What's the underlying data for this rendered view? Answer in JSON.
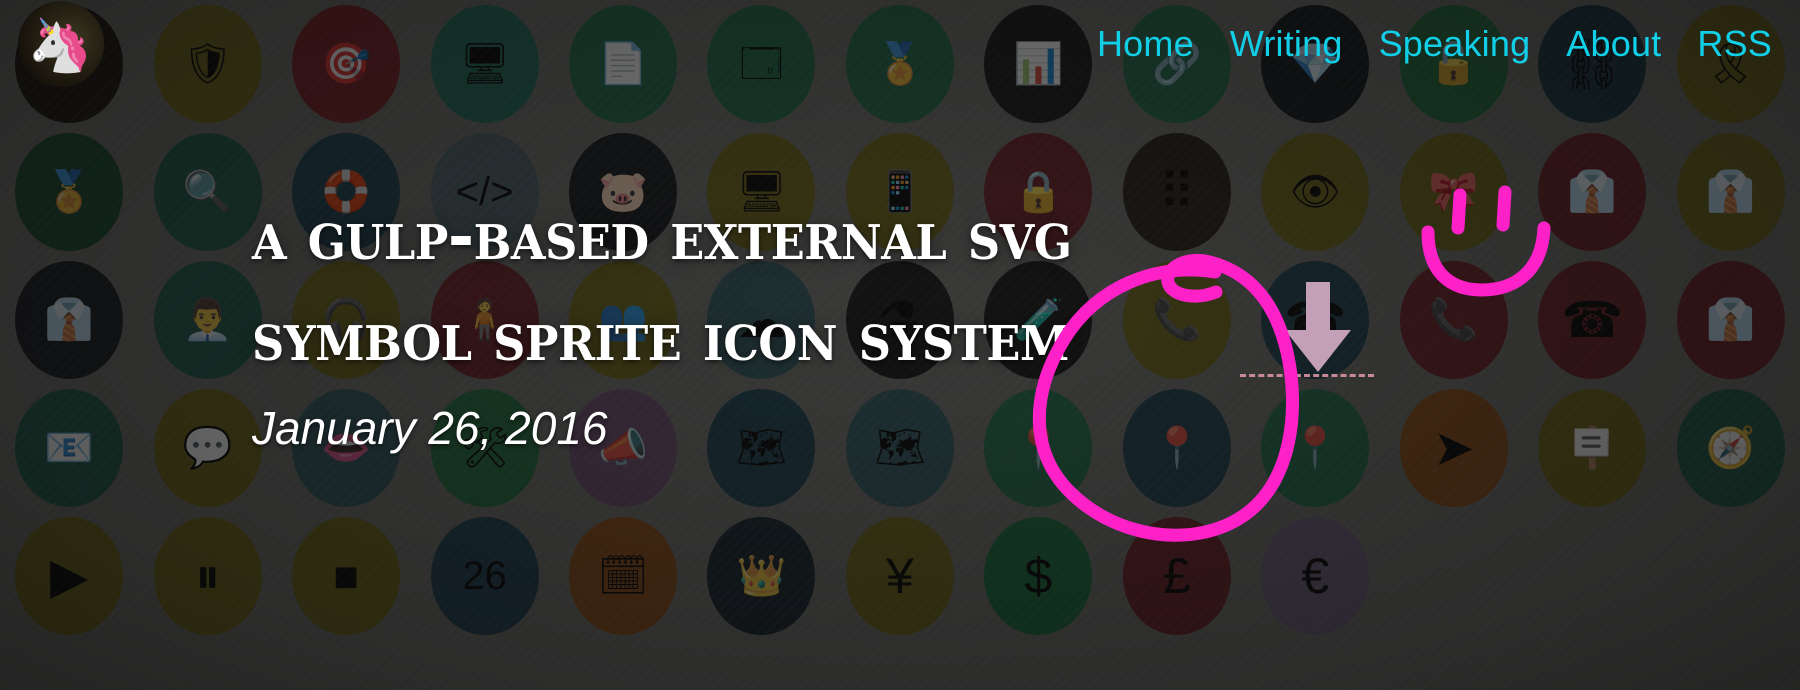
{
  "site": {
    "logo_icon": "unicorn-logo-icon",
    "logo_glyph": "🦄",
    "accent_link_color": "#12cfe8"
  },
  "nav": {
    "items": [
      {
        "label": "Home",
        "name": "nav-link-home"
      },
      {
        "label": "Writing",
        "name": "nav-link-writing"
      },
      {
        "label": "Speaking",
        "name": "nav-link-speaking"
      },
      {
        "label": "About",
        "name": "nav-link-about"
      },
      {
        "label": "RSS",
        "name": "nav-link-rss"
      }
    ]
  },
  "hero": {
    "title": "A Gulp-Based External SVG\nSymbol Sprite Icon System",
    "date": "January 26, 2016",
    "title_color": "#ffffff",
    "date_color": "#ffffff"
  },
  "download_marker": {
    "arrow_icon": "download-arrow-icon",
    "arrow_color": "#c4a0b8",
    "rule_color": "#d08e9e"
  },
  "annotations": {
    "color": "#ff21c8",
    "stroke_width": 13,
    "items": [
      {
        "name": "annotation-circle-highlight",
        "shape": "hand-drawn-circle"
      },
      {
        "name": "annotation-smiley-face",
        "shape": "smiley"
      }
    ]
  },
  "background": {
    "overlay_color": "rgba(20,20,20,0.55)",
    "base_color": "#6e6e6b",
    "icons": [
      {
        "name": "unicorn-logo-icon",
        "glyph": "",
        "bg": "#1a160e"
      },
      {
        "name": "shield-block-icon",
        "glyph": "🛡",
        "bg": "#6b6416"
      },
      {
        "name": "target-icon",
        "glyph": "🎯",
        "bg": "#7a1d22"
      },
      {
        "name": "desktop-chart-icon",
        "glyph": "🖥",
        "bg": "#1f6b5a"
      },
      {
        "name": "document-icon",
        "glyph": "📄",
        "bg": "#1f6b4a"
      },
      {
        "name": "browser-window-icon",
        "glyph": "🗔",
        "bg": "#1f6b4a"
      },
      {
        "name": "certificate-icon",
        "glyph": "🏅",
        "bg": "#1f6b4a"
      },
      {
        "name": "presentation-chart-icon",
        "glyph": "📊",
        "bg": "#141414"
      },
      {
        "name": "link-chain-icon",
        "glyph": "🔗",
        "bg": "#1f6b4a"
      },
      {
        "name": "diamond-icon",
        "glyph": "💎",
        "bg": "#0f1417"
      },
      {
        "name": "padlock-open-icon",
        "glyph": "🔓",
        "bg": "#1f6b3a"
      },
      {
        "name": "handcuffs-icon",
        "glyph": "⛓",
        "bg": "#14343f"
      },
      {
        "name": "ribbon-icon",
        "glyph": "🎗",
        "bg": "#6b6416"
      },
      {
        "name": "award-ribbon-icon",
        "glyph": "🏅",
        "bg": "#184a30"
      },
      {
        "name": "magnifier-icon",
        "glyph": "🔍",
        "bg": "#1e5a49"
      },
      {
        "name": "lifebuoy-icon",
        "glyph": "🛟",
        "bg": "#1b3f4e"
      },
      {
        "name": "code-tag-icon",
        "glyph": "</>",
        "bg": "#4c6166"
      },
      {
        "name": "piggy-bank-icon",
        "glyph": "🐷",
        "bg": "#14181b"
      },
      {
        "name": "desktop-mobile-icon",
        "glyph": "🖥",
        "bg": "#6b6416"
      },
      {
        "name": "smartphone-icon",
        "glyph": "📱",
        "bg": "#6b6416"
      },
      {
        "name": "padlock-closed-icon",
        "glyph": "🔒",
        "bg": "#6b1d24"
      },
      {
        "name": "binary-code-icon",
        "glyph": "⠿",
        "bg": "#241c14"
      },
      {
        "name": "eye-icon",
        "glyph": "👁",
        "bg": "#6b6416"
      },
      {
        "name": "bowtie-icon",
        "glyph": "🎀",
        "bg": "#6b6416"
      },
      {
        "name": "necktie-icon",
        "glyph": "👔",
        "bg": "#6b1d24"
      },
      {
        "name": "tie-dark-icon",
        "glyph": "👔",
        "bg": "#6b6416"
      },
      {
        "name": "tie-icon",
        "glyph": "👔",
        "bg": "#16191d"
      },
      {
        "name": "businessman-icon",
        "glyph": "👨‍💼",
        "bg": "#1e5a49"
      },
      {
        "name": "headphones-support-icon",
        "glyph": "🎧",
        "bg": "#6b6416"
      },
      {
        "name": "person-red-icon",
        "glyph": "🧍",
        "bg": "#6b1d24"
      },
      {
        "name": "team-group-icon",
        "glyph": "👥",
        "bg": "#6b6416"
      },
      {
        "name": "cloud-icon",
        "glyph": "☁",
        "bg": "#2f565c"
      },
      {
        "name": "science-flask-icon",
        "glyph": "⚗",
        "bg": "#141414"
      },
      {
        "name": "lab-bottle-icon",
        "glyph": "🧪",
        "bg": "#141414"
      },
      {
        "name": "phone-ring-icon",
        "glyph": "📞",
        "bg": "#6b6416"
      },
      {
        "name": "telephone-icon",
        "glyph": "☎",
        "bg": "#1b3f4e"
      },
      {
        "name": "phone-call-icon",
        "glyph": "📞",
        "bg": "#6b1d24"
      },
      {
        "name": "phone-old-icon",
        "glyph": "☎",
        "bg": "#6b1d24"
      },
      {
        "name": "tie-stripe-icon",
        "glyph": "👔",
        "bg": "#6b1d24"
      },
      {
        "name": "mobile-mail-icon",
        "glyph": "📧",
        "bg": "#1e5a49"
      },
      {
        "name": "mobile-chat-icon",
        "glyph": "💬",
        "bg": "#6b6416"
      },
      {
        "name": "lips-icon",
        "glyph": "👄",
        "bg": "#2f565c"
      },
      {
        "name": "hammer-wrench-icon",
        "glyph": "🛠",
        "bg": "#1f6b3a"
      },
      {
        "name": "megaphone-icon",
        "glyph": "📣",
        "bg": "#6a4a6b"
      },
      {
        "name": "map-folded-icon",
        "glyph": "🗺",
        "bg": "#1b3f4e"
      },
      {
        "name": "map-pin-route-icon",
        "glyph": "🗺",
        "bg": "#2f565c"
      },
      {
        "name": "location-pin-red-icon",
        "glyph": "📍",
        "bg": "#1f6b4a"
      },
      {
        "name": "location-pin-gold-icon",
        "glyph": "📍",
        "bg": "#1b3f4e"
      },
      {
        "name": "location-pin-icon",
        "glyph": "📍",
        "bg": "#1f6b4a"
      },
      {
        "name": "navigation-arrow-icon",
        "glyph": "➤",
        "bg": "#8a4a14"
      },
      {
        "name": "signpost-icon",
        "glyph": "🪧",
        "bg": "#6b6416"
      },
      {
        "name": "compass-icon",
        "glyph": "🧭",
        "bg": "#1e5a49"
      },
      {
        "name": "play-slider-icon",
        "glyph": "▶",
        "bg": "#6b6416"
      },
      {
        "name": "pause-slider-icon",
        "glyph": "⏸",
        "bg": "#6b6416"
      },
      {
        "name": "stop-slider-icon",
        "glyph": "⏹",
        "bg": "#6b6416"
      },
      {
        "name": "calendar-26-icon",
        "glyph": "26",
        "bg": "#1b3f4e"
      },
      {
        "name": "calendar-grid-icon",
        "glyph": "🗓",
        "bg": "#8a4a14"
      },
      {
        "name": "crown-icon",
        "glyph": "👑",
        "bg": "#14222c"
      },
      {
        "name": "money-bag-yen-icon",
        "glyph": "¥",
        "bg": "#6b6416"
      },
      {
        "name": "money-bag-dollar-icon",
        "glyph": "$",
        "bg": "#176b3a"
      },
      {
        "name": "money-bag-pound-icon",
        "glyph": "£",
        "bg": "#6b1d24"
      },
      {
        "name": "money-bag-euro-icon",
        "glyph": "€",
        "bg": "#6a5d7a"
      }
    ]
  }
}
